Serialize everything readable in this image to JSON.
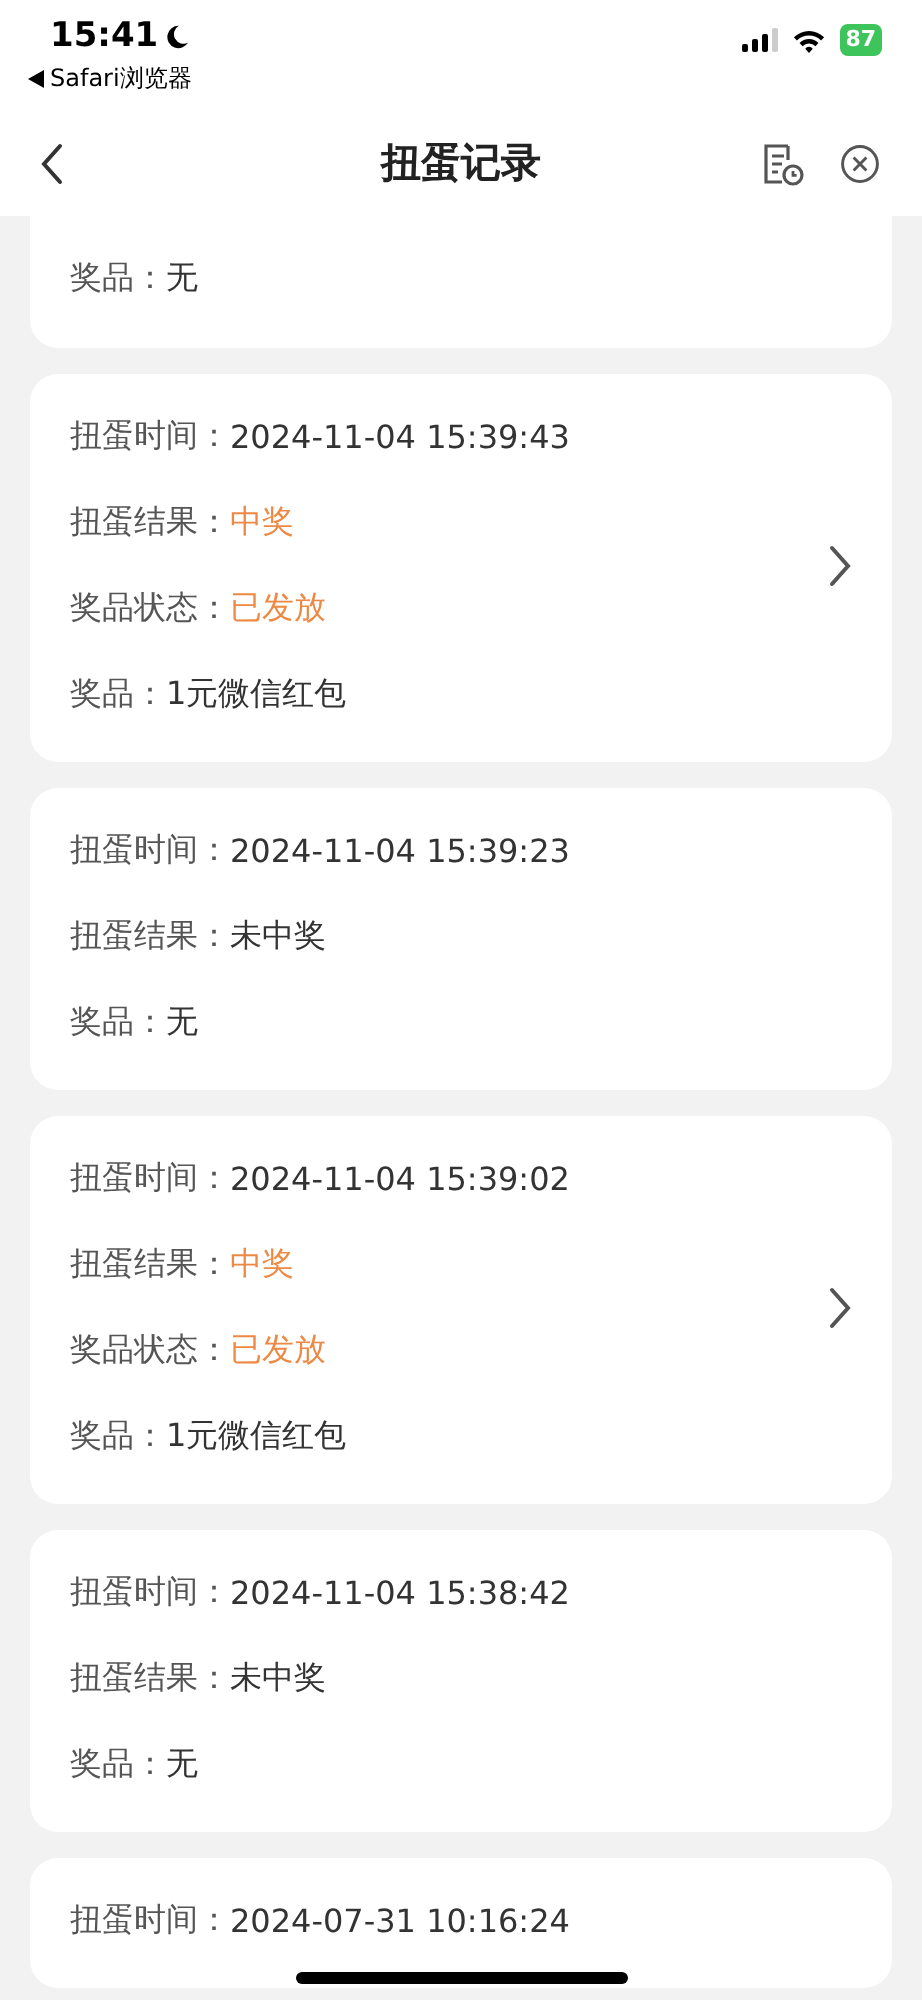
{
  "status_bar": {
    "time": "15:41",
    "back_app": "Safari浏览器",
    "battery": "87"
  },
  "header": {
    "title": "扭蛋记录"
  },
  "records": [
    {
      "cut_top": true,
      "has_detail": false,
      "rows": [
        {
          "label": "奖品：",
          "value": "无",
          "kind": "normal"
        }
      ]
    },
    {
      "cut_top": false,
      "has_detail": true,
      "rows": [
        {
          "label": "扭蛋时间：",
          "value": "2024-11-04 15:39:43",
          "kind": "normal"
        },
        {
          "label": "扭蛋结果：",
          "value": "中奖",
          "kind": "highlight"
        },
        {
          "label": "奖品状态：",
          "value": "已发放",
          "kind": "highlight"
        },
        {
          "label": "奖品：",
          "value": "1元微信红包",
          "kind": "normal"
        }
      ]
    },
    {
      "cut_top": false,
      "has_detail": false,
      "rows": [
        {
          "label": "扭蛋时间：",
          "value": "2024-11-04 15:39:23",
          "kind": "normal"
        },
        {
          "label": "扭蛋结果：",
          "value": "未中奖",
          "kind": "normal"
        },
        {
          "label": "奖品：",
          "value": "无",
          "kind": "normal"
        }
      ]
    },
    {
      "cut_top": false,
      "has_detail": true,
      "rows": [
        {
          "label": "扭蛋时间：",
          "value": "2024-11-04 15:39:02",
          "kind": "normal"
        },
        {
          "label": "扭蛋结果：",
          "value": "中奖",
          "kind": "highlight"
        },
        {
          "label": "奖品状态：",
          "value": "已发放",
          "kind": "highlight"
        },
        {
          "label": "奖品：",
          "value": "1元微信红包",
          "kind": "normal"
        }
      ]
    },
    {
      "cut_top": false,
      "has_detail": false,
      "rows": [
        {
          "label": "扭蛋时间：",
          "value": "2024-11-04 15:38:42",
          "kind": "normal"
        },
        {
          "label": "扭蛋结果：",
          "value": "未中奖",
          "kind": "normal"
        },
        {
          "label": "奖品：",
          "value": "无",
          "kind": "normal"
        }
      ]
    },
    {
      "cut_top": false,
      "has_detail": false,
      "rows": [
        {
          "label": "扭蛋时间：",
          "value": "2024-07-31 10:16:24",
          "kind": "normal"
        }
      ]
    }
  ]
}
